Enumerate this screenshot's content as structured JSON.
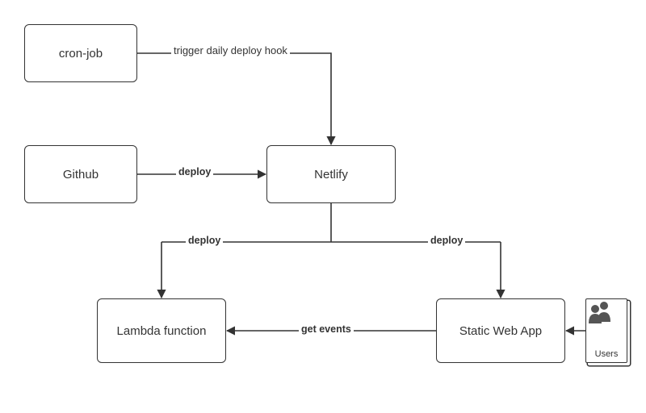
{
  "nodes": {
    "cronjob": "cron-job",
    "github": "Github",
    "netlify": "Netlify",
    "lambda": "Lambda function",
    "webapp": "Static Web App",
    "users": "Users"
  },
  "edges": {
    "cron_to_netlify": "trigger daily deploy hook",
    "github_to_netlify": "deploy",
    "netlify_to_lambda": "deploy",
    "netlify_to_webapp": "deploy",
    "webapp_to_lambda": "get events"
  }
}
